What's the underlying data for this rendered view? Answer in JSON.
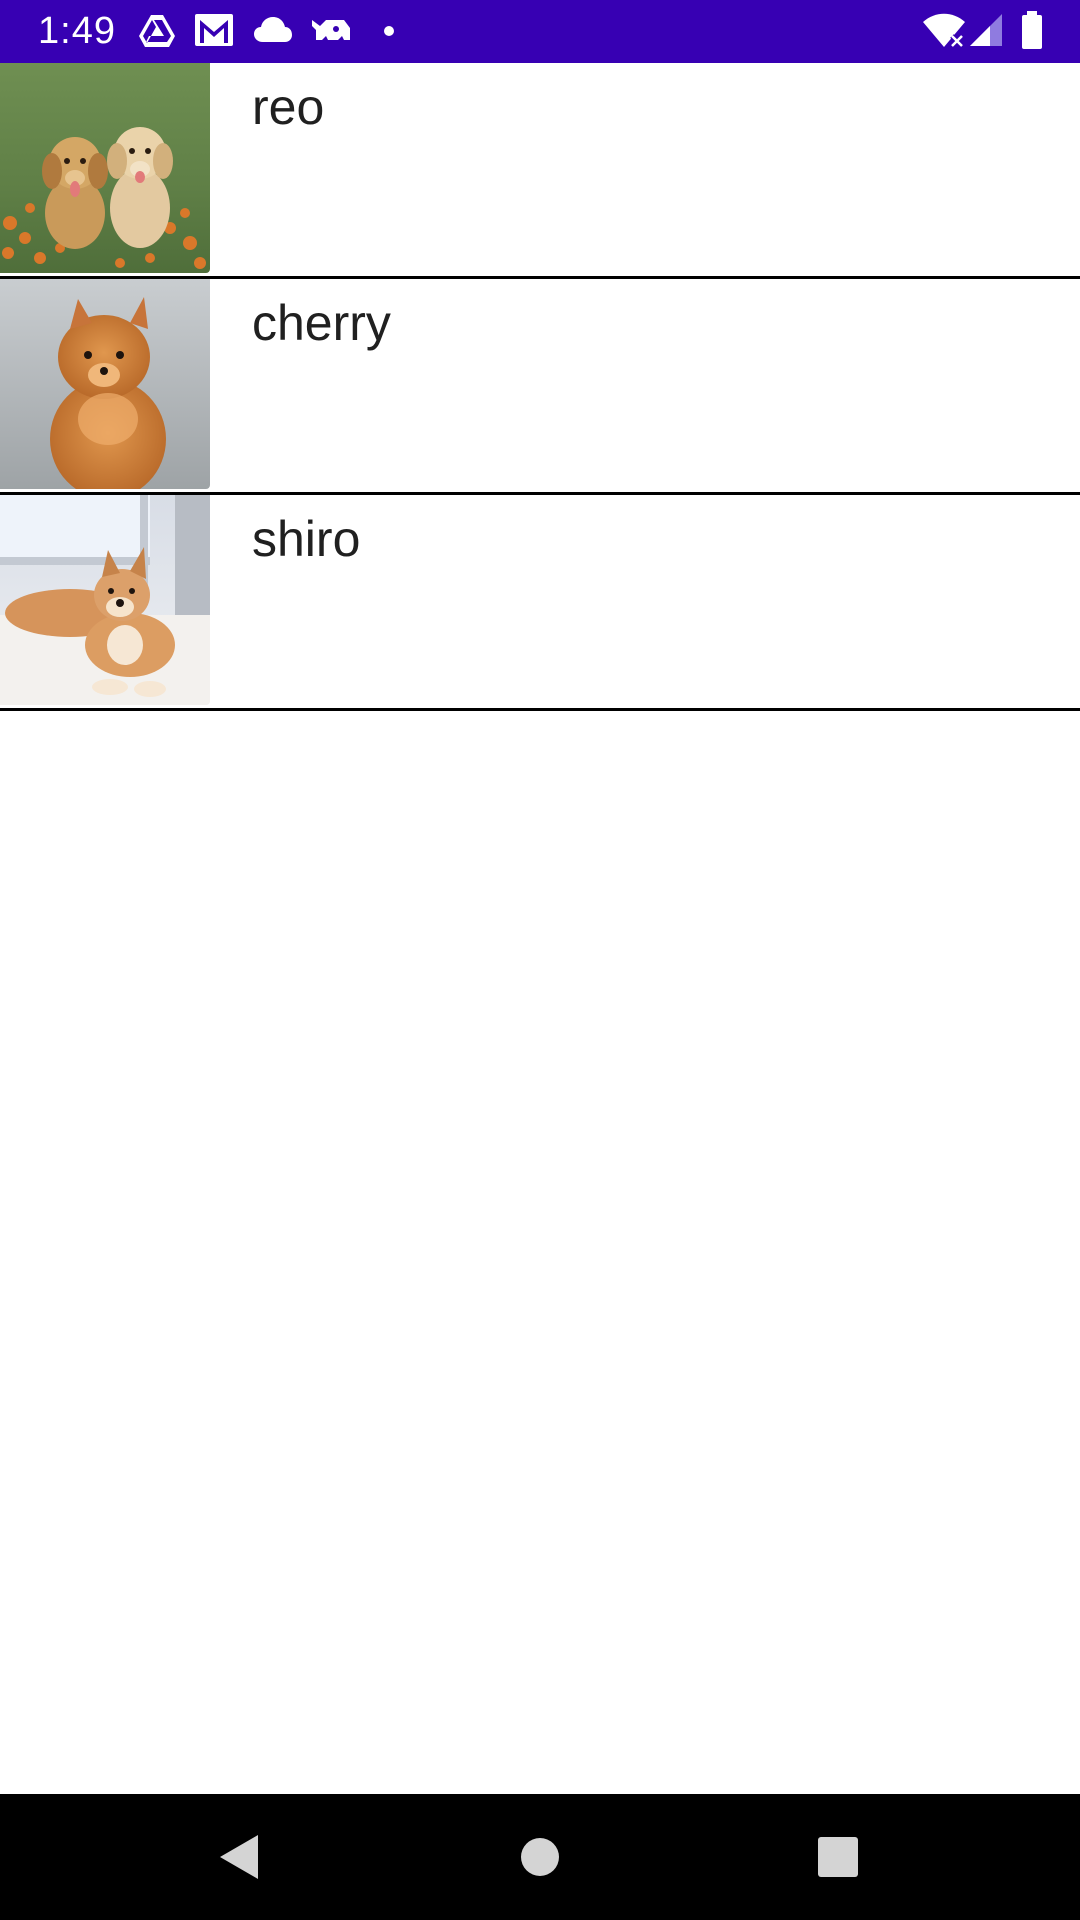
{
  "status_bar": {
    "time": "1:49",
    "background": "#3700b3",
    "left_icons": [
      "drive-icon",
      "gmail-icon",
      "cloud-icon",
      "sms-icon",
      "dot-icon"
    ],
    "right_icons": [
      "wifi-icon",
      "signal-icon",
      "battery-icon"
    ]
  },
  "dogs": [
    {
      "name": "reo",
      "photo": "two-golden-puppies-in-flower-field"
    },
    {
      "name": "cherry",
      "photo": "fluffy-orange-pomeranian"
    },
    {
      "name": "shiro",
      "photo": "shiba-inu-lying-on-rug"
    }
  ],
  "nav_bar": {
    "background": "#000000",
    "buttons": [
      "back-icon",
      "home-icon",
      "recents-icon"
    ]
  }
}
